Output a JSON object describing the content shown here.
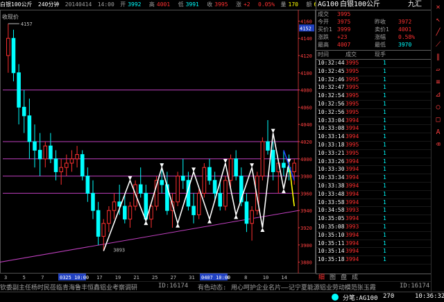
{
  "topbar": {
    "symbol": "白银100公斤",
    "period": "240分钟",
    "date": "20140414",
    "time": "14:00",
    "open_label": "开",
    "open": "3992",
    "high_label": "高",
    "high": "4001",
    "low_label": "低",
    "low": "3991",
    "close_label": "收",
    "close": "3995",
    "chg_label": "涨",
    "chg": "+2",
    "chg_pct": "0.05%",
    "vol_label": "量",
    "vol": "170",
    "amt_label": "额",
    "amt": "679221",
    "oi": "3294"
  },
  "chart": {
    "corner_label": "收现价",
    "price_ticks": [
      "4160",
      "4140",
      "4120",
      "4100",
      "4080",
      "4060",
      "4040",
      "4020",
      "4000",
      "3980",
      "3960",
      "3940",
      "3920",
      "3900",
      "3880"
    ],
    "current_price_tag": "4152",
    "high_marker": "4157",
    "low_marker": "3893",
    "date_labels": [
      "3",
      "5",
      "7",
      "11",
      "13",
      "17",
      "19",
      "21",
      "25",
      "27",
      "31",
      "2",
      "4",
      "8",
      "10",
      "14"
    ],
    "date_highlight_1": "0325 10:00",
    "date_highlight_2": "0407 10:00"
  },
  "chart_data": {
    "type": "candlestick",
    "ylim": [
      3870,
      4170
    ],
    "ohlc": [
      [
        4120,
        4157,
        4100,
        4140
      ],
      [
        4140,
        4150,
        4090,
        4100
      ],
      [
        4100,
        4110,
        4040,
        4060
      ],
      [
        4060,
        4080,
        4030,
        4050
      ],
      [
        4050,
        4070,
        4000,
        4020
      ],
      [
        4020,
        4040,
        3990,
        4010
      ],
      [
        4010,
        4030,
        3980,
        4000
      ],
      [
        4000,
        4020,
        3990,
        4015
      ],
      [
        4015,
        4030,
        3995,
        4000
      ],
      [
        4000,
        4010,
        3975,
        3985
      ],
      [
        3985,
        4000,
        3970,
        3990
      ],
      [
        3990,
        4005,
        3980,
        3995
      ],
      [
        3995,
        4010,
        3985,
        4000
      ],
      [
        4000,
        4015,
        3990,
        4005
      ],
      [
        4005,
        4010,
        3975,
        3980
      ],
      [
        3980,
        3990,
        3950,
        3960
      ],
      [
        3960,
        3975,
        3930,
        3940
      ],
      [
        3940,
        3950,
        3900,
        3910
      ],
      [
        3910,
        3930,
        3893,
        3925
      ],
      [
        3925,
        3945,
        3915,
        3940
      ],
      [
        3940,
        3960,
        3930,
        3950
      ],
      [
        3950,
        3970,
        3935,
        3945
      ],
      [
        3945,
        3960,
        3925,
        3930
      ],
      [
        3930,
        3950,
        3920,
        3945
      ],
      [
        3945,
        3975,
        3940,
        3970
      ],
      [
        3970,
        3990,
        3955,
        3960
      ],
      [
        3960,
        3970,
        3925,
        3930
      ],
      [
        3930,
        3950,
        3920,
        3945
      ],
      [
        3945,
        3980,
        3940,
        3975
      ],
      [
        3975,
        3995,
        3960,
        3970
      ],
      [
        3970,
        3985,
        3935,
        3940
      ],
      [
        3940,
        3960,
        3920,
        3950
      ],
      [
        3950,
        3985,
        3945,
        3980
      ],
      [
        3980,
        4000,
        3965,
        3975
      ],
      [
        3975,
        3985,
        3940,
        3945
      ],
      [
        3945,
        3960,
        3925,
        3935
      ],
      [
        3935,
        3965,
        3930,
        3960
      ],
      [
        3960,
        3995,
        3955,
        3990
      ],
      [
        3990,
        4000,
        3970,
        3975
      ],
      [
        3975,
        3985,
        3950,
        3960
      ],
      [
        3960,
        3975,
        3940,
        3945
      ],
      [
        3945,
        3980,
        3940,
        3975
      ],
      [
        3975,
        4005,
        3965,
        4000
      ],
      [
        4000,
        4010,
        3975,
        3980
      ],
      [
        3980,
        3990,
        3945,
        3950
      ],
      [
        3950,
        3960,
        3915,
        3925
      ],
      [
        3925,
        3945,
        3905,
        3940
      ],
      [
        3940,
        3985,
        3935,
        3980
      ],
      [
        3980,
        4025,
        3975,
        4020
      ],
      [
        4020,
        4045,
        4005,
        4010
      ],
      [
        4010,
        4020,
        3975,
        3985
      ],
      [
        3985,
        4000,
        3960,
        3995
      ],
      [
        3995,
        4010,
        3980,
        3990
      ],
      [
        3990,
        4005,
        3975,
        3985
      ],
      [
        3985,
        4000,
        3970,
        3995
      ]
    ],
    "hlines": [
      4080,
      4020,
      4000,
      3980,
      3960
    ],
    "support_line": [
      [
        0,
        3880
      ],
      [
        54,
        3940
      ]
    ],
    "zigzag": [
      [
        18,
        3893
      ],
      [
        23,
        3975
      ],
      [
        26,
        3928
      ],
      [
        29,
        3990
      ],
      [
        32,
        3925
      ],
      [
        35,
        3985
      ],
      [
        38,
        3930
      ],
      [
        41,
        3995
      ],
      [
        43,
        3935
      ],
      [
        46,
        3990
      ],
      [
        48,
        3920
      ],
      [
        50,
        4030
      ],
      [
        52,
        3965
      ],
      [
        53,
        3995
      ]
    ],
    "projection_yellow": [
      [
        53,
        3995
      ],
      [
        54,
        3945
      ]
    ],
    "projection_blue": [
      [
        52,
        4010
      ],
      [
        54,
        3975
      ]
    ]
  },
  "panel": {
    "code": "AG100",
    "name": "白银100公斤",
    "exchange": "九汇",
    "rows": [
      {
        "l1": "成交",
        "v1": "3995",
        "l2": "",
        "v2": ""
      },
      {
        "l1": "今开",
        "v1": "3975",
        "l2": "昨收",
        "v2": "3972"
      },
      {
        "l1": "买价1",
        "v1": "3999",
        "l2": "卖价1",
        "v2": "4001"
      },
      {
        "l1": "涨跌",
        "v1": "+23",
        "l2": "涨幅",
        "v2": "0.58%"
      },
      {
        "l1": "最高",
        "v1": "4007",
        "l2": "最低",
        "v2": "3970"
      }
    ],
    "ticks_header": [
      "时间",
      "成交",
      "现手"
    ],
    "ticks": [
      {
        "t": "10:32:44",
        "p": "3995",
        "v": "1"
      },
      {
        "t": "10:32:45",
        "p": "3995",
        "v": "1"
      },
      {
        "t": "10:32:46",
        "p": "3995",
        "v": "1"
      },
      {
        "t": "10:32:47",
        "p": "3995",
        "v": "1"
      },
      {
        "t": "10:32:54",
        "p": "3995",
        "v": "1"
      },
      {
        "t": "10:32:56",
        "p": "3995",
        "v": "1"
      },
      {
        "t": "10:32:56",
        "p": "3995",
        "v": "1"
      },
      {
        "t": "10:33:04",
        "p": "3994",
        "v": "1"
      },
      {
        "t": "10:33:08",
        "p": "3994",
        "v": "1"
      },
      {
        "t": "10:33:14",
        "p": "3994",
        "v": "1"
      },
      {
        "t": "10:33:18",
        "p": "3995",
        "v": "1"
      },
      {
        "t": "10:33:21",
        "p": "3995",
        "v": "1"
      },
      {
        "t": "10:33:26",
        "p": "3994",
        "v": "1"
      },
      {
        "t": "10:33:30",
        "p": "3994",
        "v": "1"
      },
      {
        "t": "10:33:34",
        "p": "3994",
        "v": "1"
      },
      {
        "t": "10:33:38",
        "p": "3994",
        "v": "1"
      },
      {
        "t": "10:33:48",
        "p": "3994",
        "v": "1"
      },
      {
        "t": "10:33:58",
        "p": "3994",
        "v": "1"
      },
      {
        "t": "10:34:58",
        "p": "3993",
        "v": "1"
      },
      {
        "t": "10:35:05",
        "p": "3994",
        "v": "1"
      },
      {
        "t": "10:35:08",
        "p": "3993",
        "v": "1"
      },
      {
        "t": "10:35:10",
        "p": "3994",
        "v": "1"
      },
      {
        "t": "10:35:11",
        "p": "3994",
        "v": "1"
      },
      {
        "t": "10:35:14",
        "p": "3994",
        "v": "1"
      },
      {
        "t": "10:35:18",
        "p": "3994",
        "v": "1"
      }
    ],
    "tabs": [
      "细",
      "图",
      "盘",
      "成"
    ]
  },
  "bottom": {
    "ticker_text": "钦委副主任杨时民莅临青海鲁丰恒鑫铝业考察调研",
    "id_label": "ID:16174",
    "news_label": "有色动态:",
    "news_text": "用心呵护企业名片——记宁夏能源铝业劳动模范张玉霞",
    "id_label_2": "ID:16174",
    "status_code": "分笔:AG100",
    "status_value": "270",
    "clock": "10:36:32"
  },
  "colors": {
    "up": "#ff3030",
    "down": "#00ffff",
    "hline": "#c040c0",
    "zigzag": "#ffffff",
    "projection": "#ffff00",
    "projection2": "#2040ff"
  }
}
